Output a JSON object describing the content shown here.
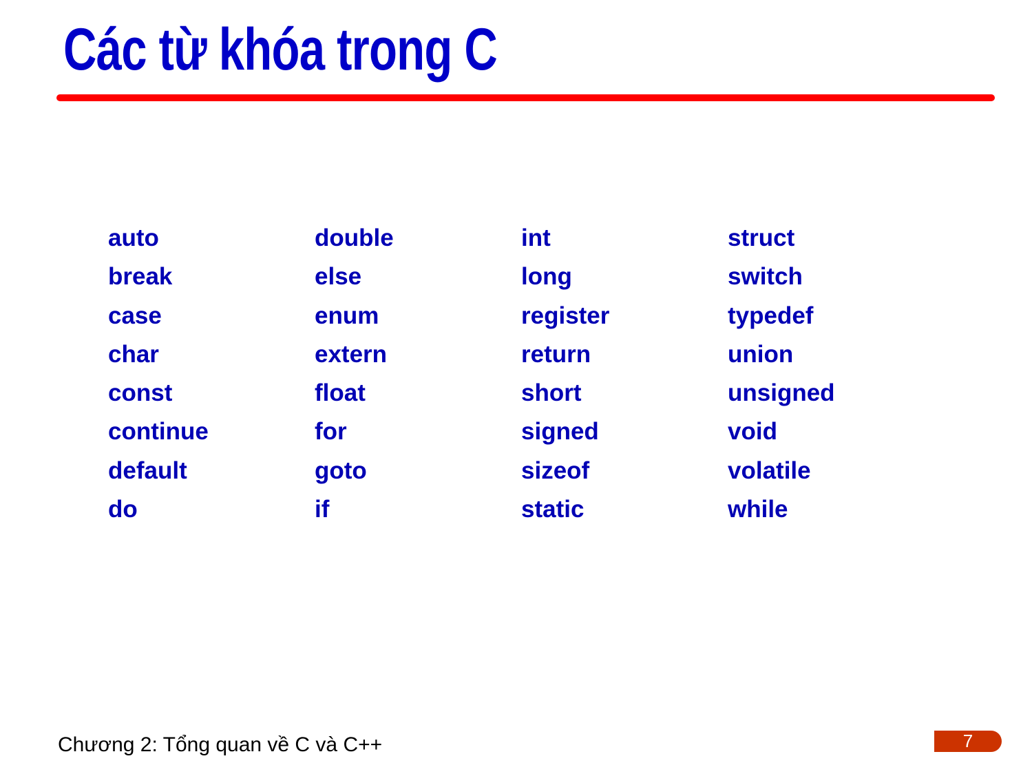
{
  "slide": {
    "title": "Các từ khóa trong C",
    "keyword_columns": [
      [
        "auto",
        "break",
        "case",
        "char",
        "const",
        "continue",
        "default",
        "do"
      ],
      [
        "double",
        "else",
        "enum",
        "extern",
        "float",
        "for",
        "goto",
        "if"
      ],
      [
        "int",
        "long",
        "register",
        "return",
        "short",
        "signed",
        "sizeof",
        "static"
      ],
      [
        "struct",
        "switch",
        "typedef",
        "union",
        "unsigned",
        "void",
        "volatile",
        "while"
      ]
    ],
    "footer": "Chương 2: Tổng quan về C và C++",
    "page_number": "7"
  },
  "colors": {
    "title": "#0000c8",
    "title_rule": "#ff0000",
    "keywords": "#0000b4",
    "page_badge": "#cc3300"
  }
}
